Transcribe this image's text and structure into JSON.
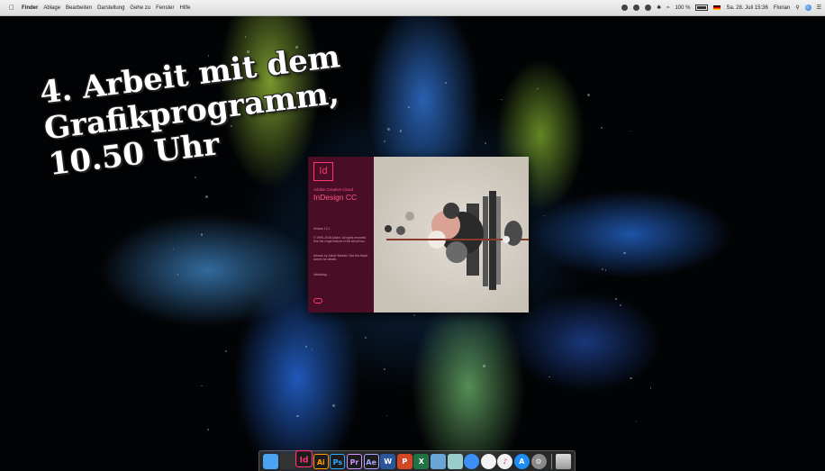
{
  "menubar": {
    "apple_icon": "apple-icon",
    "items": [
      {
        "label": "Finder",
        "bold": true
      },
      {
        "label": "Ablage"
      },
      {
        "label": "Bearbeiten"
      },
      {
        "label": "Darstellung"
      },
      {
        "label": "Gehe zu"
      },
      {
        "label": "Fenster"
      },
      {
        "label": "Hilfe"
      }
    ],
    "battery_text": "100 %",
    "datetime": "Sa. 28. Juli 15:36",
    "user": "Florian"
  },
  "overlay": {
    "line1": "4. Arbeit mit dem",
    "line2": "Grafikprogramm,",
    "line3": "10.50 Uhr"
  },
  "splash": {
    "logo": "Id",
    "brand": "Adobe Creative Cloud",
    "product": "InDesign CC",
    "version": "Version 13.1",
    "copyright": "© 1999–2018 Adobe. All rights reserved. See the Legal Notices in the About box.",
    "credits": "Artwork by Jakub Waleski. See the About screen for details.",
    "loading": "Initializing…",
    "accent": "#ff3670",
    "panel_color": "#4a0d26"
  },
  "dock": {
    "apps": [
      {
        "name": "finder-icon",
        "label": "",
        "bg": "#4aa3f0",
        "fg": "#fff"
      },
      {
        "name": "launchpad-icon",
        "label": "",
        "bg": "#333",
        "fg": "#ccc"
      },
      {
        "name": "indesign-icon",
        "label": "Id",
        "fg": "#ff3670",
        "active": true
      },
      {
        "name": "illustrator-icon",
        "label": "Ai",
        "fg": "#ff9a00"
      },
      {
        "name": "photoshop-icon",
        "label": "Ps",
        "fg": "#31a8ff"
      },
      {
        "name": "premiere-icon",
        "label": "Pr",
        "fg": "#d291ff"
      },
      {
        "name": "after-effects-icon",
        "label": "Ae",
        "fg": "#a4a4ff"
      },
      {
        "name": "word-icon",
        "label": "W",
        "bg": "#2b579a",
        "fg": "#fff"
      },
      {
        "name": "powerpoint-icon",
        "label": "P",
        "bg": "#d24726",
        "fg": "#fff"
      },
      {
        "name": "excel-icon",
        "label": "X",
        "bg": "#217346",
        "fg": "#fff"
      },
      {
        "name": "preview-icon",
        "label": "",
        "bg": "#6aa5d8",
        "fg": "#fff"
      },
      {
        "name": "image-capture-icon",
        "label": "",
        "bg": "#9cc",
        "fg": "#fff"
      },
      {
        "name": "safari-icon",
        "label": "",
        "bg": "#3d8ef5",
        "fg": "#fff",
        "round": true
      },
      {
        "name": "photos-icon",
        "label": "",
        "bg": "#f3f3f3",
        "fg": "#e44",
        "round": true
      },
      {
        "name": "itunes-icon",
        "label": "♪",
        "bg": "#f0f0f0",
        "fg": "#e0397a",
        "round": true
      },
      {
        "name": "app-store-icon",
        "label": "A",
        "bg": "#1d8cf5",
        "fg": "#fff",
        "round": true
      },
      {
        "name": "system-preferences-icon",
        "label": "⚙",
        "bg": "#8a8a8a",
        "fg": "#eee",
        "round": true
      }
    ],
    "trash": {
      "name": "trash-icon"
    }
  }
}
